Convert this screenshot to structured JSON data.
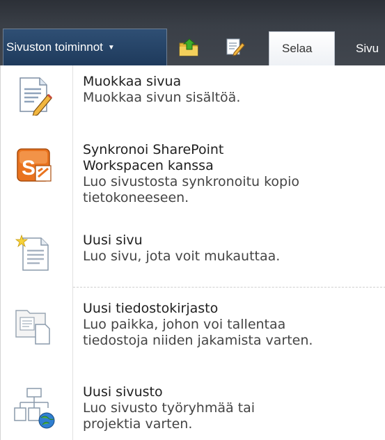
{
  "toolbar": {
    "site_actions_label": "Sivuston toiminnot",
    "tabs": [
      {
        "label": "Selaa"
      },
      {
        "label": "Sivu"
      }
    ]
  },
  "menu": {
    "items": [
      {
        "title": "Muokkaa sivua",
        "description": "Muokkaa sivun sisältöä.",
        "icon": "edit-page-icon"
      },
      {
        "title": "Synkronoi SharePoint Workspacen kanssa",
        "description": "Luo sivustosta synkronoitu kopio tietokoneeseen.",
        "icon": "sharepoint-workspace-icon"
      },
      {
        "title": "Uusi sivu",
        "description": "Luo sivu, jota voit mukauttaa.",
        "icon": "new-page-icon"
      },
      {
        "title": "Uusi tiedostokirjasto",
        "description": "Luo paikka, johon voi tallentaa tiedostoja niiden jakamista varten.",
        "icon": "new-library-icon"
      },
      {
        "title": "Uusi sivusto",
        "description": "Luo sivusto työryhmää tai projektia varten.",
        "icon": "new-site-icon"
      }
    ]
  }
}
